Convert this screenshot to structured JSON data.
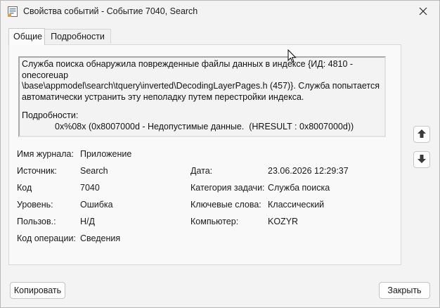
{
  "window": {
    "title": "Свойства событий - Событие 7040, Search"
  },
  "tabs": [
    {
      "label": "Общие",
      "active": true
    },
    {
      "label": "Подробности",
      "active": false
    }
  ],
  "description": {
    "line1": "Служба поиска обнаружила поврежденные файлы данных в индексе {ИД: 4810 - onecoreuap",
    "line2": "\\base\\appmodel\\search\\tquery\\inverted\\DecodingLayerPages.h (457)}. Служба попытается",
    "line3": "автоматически устранить эту неполадку путем перестройки индекса.",
    "details_label": "Подробности:",
    "details_value": "0x%08x (0x8007000d - Недопустимые данные.  (HRESULT : 0x8007000d))"
  },
  "fields": {
    "log_name_label": "Имя журнала:",
    "log_name_value": "Приложение",
    "source_label": "Источник:",
    "source_value": "Search",
    "date_label": "Дата:",
    "date_value": "23.06.2026 12:29:37",
    "code_label": "Код",
    "code_value": "7040",
    "task_category_label": "Категория задачи:",
    "task_category_value": "Служба поиска",
    "level_label": "Уровень:",
    "level_value": "Ошибка",
    "keywords_label": "Ключевые слова:",
    "keywords_value": "Классический",
    "user_label": "Пользов.:",
    "user_value": "Н/Д",
    "computer_label": "Компьютер:",
    "computer_value": "KOZYR",
    "opcode_label": "Код операции:",
    "opcode_value": "Сведения"
  },
  "buttons": {
    "copy": "Копировать",
    "close": "Закрыть"
  },
  "icons": {
    "title": "event-properties-icon",
    "close": "close-icon",
    "up": "arrow-up-icon",
    "down": "arrow-down-icon"
  }
}
